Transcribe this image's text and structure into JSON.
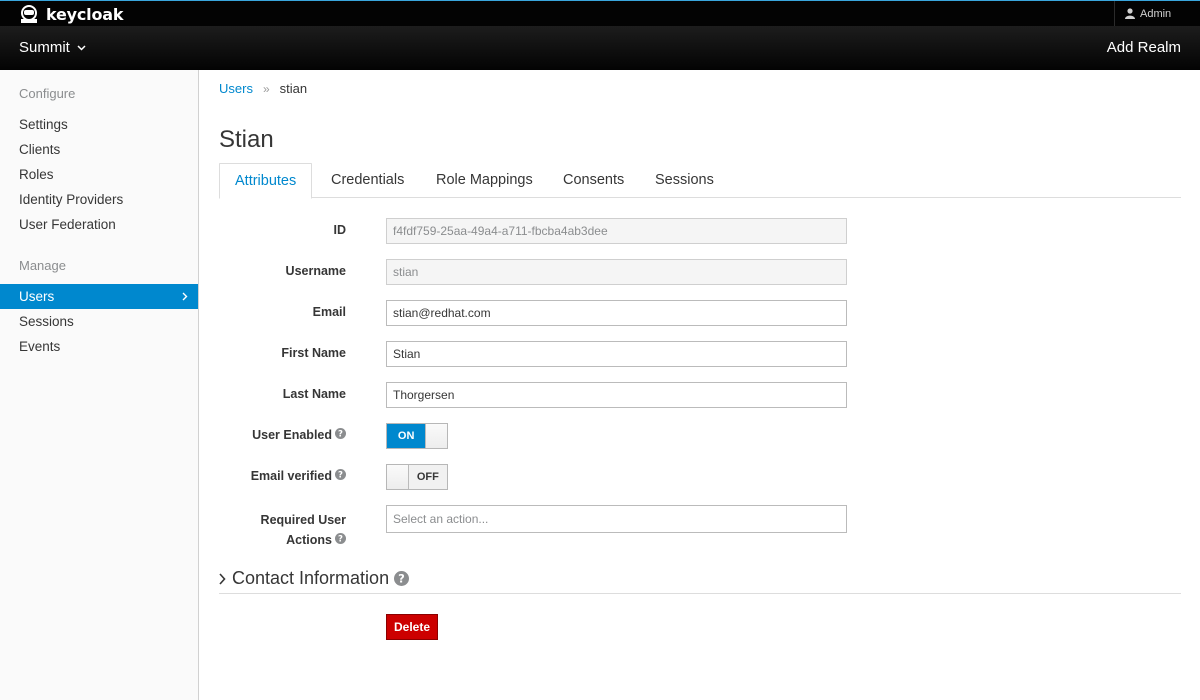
{
  "brand": {
    "logo_text": "keycloak"
  },
  "topbar": {
    "user_menu_label": "Admin"
  },
  "realmbar": {
    "realm_name": "Summit",
    "add_realm_label": "Add Realm"
  },
  "sidebar": {
    "configure_heading": "Configure",
    "configure_items": [
      "Settings",
      "Clients",
      "Roles",
      "Identity Providers",
      "User Federation"
    ],
    "manage_heading": "Manage",
    "manage_items": [
      "Users",
      "Sessions",
      "Events"
    ],
    "active_item": "Users"
  },
  "breadcrumb": {
    "parent": "Users",
    "separator": "»",
    "current": "stian"
  },
  "page_title": "Stian",
  "tabs": [
    "Attributes",
    "Credentials",
    "Role Mappings",
    "Consents",
    "Sessions"
  ],
  "active_tab": "Attributes",
  "form": {
    "id_label": "ID",
    "id_value": "f4fdf759-25aa-49a4-a711-fbcba4ab3dee",
    "username_label": "Username",
    "username_value": "stian",
    "email_label": "Email",
    "email_value": "stian@redhat.com",
    "first_name_label": "First Name",
    "first_name_value": "Stian",
    "last_name_label": "Last Name",
    "last_name_value": "Thorgersen",
    "user_enabled_label": "User Enabled",
    "user_enabled_state": "ON",
    "email_verified_label": "Email verified",
    "email_verified_state": "OFF",
    "required_actions_label_line1": "Required User",
    "required_actions_label_line2": "Actions",
    "required_actions_placeholder": "Select an action..."
  },
  "contact_section_title": "Contact Information",
  "delete_label": "Delete",
  "colors": {
    "accent": "#0088ce",
    "danger": "#cc0000",
    "topbar": "#030303"
  },
  "icons": [
    "user-icon",
    "chevron-down-icon",
    "chevron-right-icon",
    "help-icon",
    "keycloak-logo-icon"
  ]
}
